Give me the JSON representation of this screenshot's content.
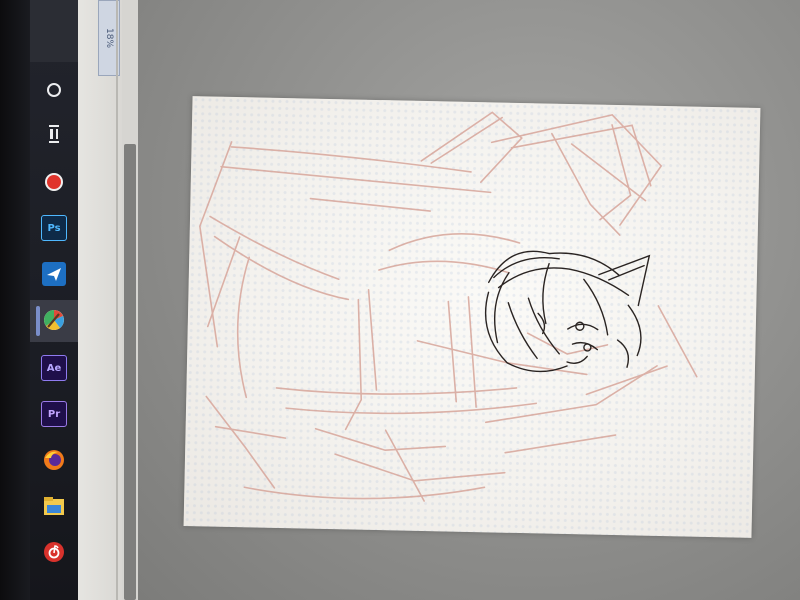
{
  "zoom": {
    "label": "18%"
  },
  "taskbar": {
    "items": [
      {
        "name": "start-circle-icon",
        "label": ""
      },
      {
        "name": "task-view-icon",
        "label": ""
      },
      {
        "name": "record-icon",
        "label": ""
      },
      {
        "name": "photoshop-icon",
        "label": "Ps"
      },
      {
        "name": "paper-plane-icon",
        "label": ""
      },
      {
        "name": "paint-app-icon",
        "label": ""
      },
      {
        "name": "after-effects-icon",
        "label": "Ae"
      },
      {
        "name": "premiere-icon",
        "label": "Pr"
      },
      {
        "name": "firefox-icon",
        "label": ""
      },
      {
        "name": "file-explorer-icon",
        "label": ""
      },
      {
        "name": "netease-music-icon",
        "label": ""
      }
    ],
    "colors": {
      "record": "#e0342c",
      "photoshop_bg": "#0e2a48",
      "photoshop_fg": "#4fb8ff",
      "after_effects_bg": "#1f0f4a",
      "after_effects_fg": "#b7a7ff",
      "premiere_bg": "#1f0f4a",
      "premiere_fg": "#c2a5ff",
      "netease": "#d8322c"
    }
  },
  "canvas": {
    "sketch_color": "#d7a59a",
    "lineart_color": "#2a2422"
  }
}
